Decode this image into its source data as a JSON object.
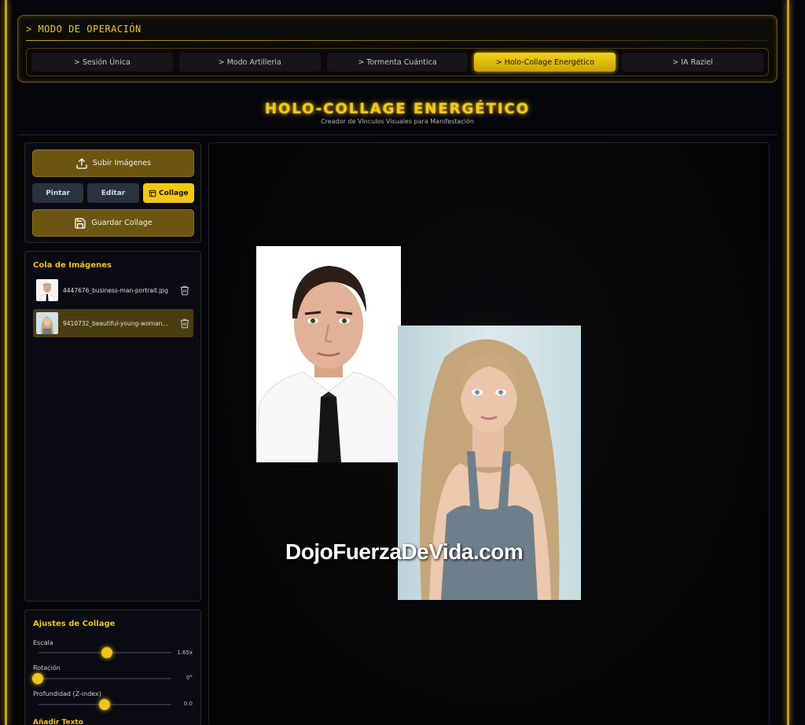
{
  "mode": {
    "title": "> MODO DE OPERACIÓN",
    "tabs": [
      {
        "label": "> Sesión Única",
        "active": false
      },
      {
        "label": "> Modo Artilleria",
        "active": false
      },
      {
        "label": "> Tormenta Cuántica",
        "active": false
      },
      {
        "label": "> Holo-Collage Energético",
        "active": true
      },
      {
        "label": "> IA Raziel",
        "active": false
      }
    ]
  },
  "header": {
    "title": "HOLO-COLLAGE ENERGÉTICO",
    "subtitle": "Creador de Vínculos Visuales para Manifestación"
  },
  "tools": {
    "upload_label": "Subir Imágenes",
    "paint_label": "Pintar",
    "edit_label": "Editar",
    "collage_label": "Collage",
    "save_label": "Guardar Collage"
  },
  "queue": {
    "title": "Cola de Imágenes",
    "items": [
      {
        "name": "4447676_business-man-portrait.jpg",
        "selected": false
      },
      {
        "name": "9410732_beautiful-young-woman...",
        "selected": true
      }
    ]
  },
  "settings": {
    "title": "Ajustes de Collage",
    "scale": {
      "label": "Escala",
      "value": "1.65x",
      "level": 0.52
    },
    "rotation": {
      "label": "Rotación",
      "value": "0°",
      "level": 0.0
    },
    "depth": {
      "label": "Profundidad (Z-index)",
      "value": "0.0",
      "level": 0.5
    },
    "next_label": "Añadir Texto"
  },
  "canvas": {
    "watermark": "DojoFuerzaDeVida.com"
  },
  "colors": {
    "accent": "#f0c418",
    "accent_dark": "#6b5510",
    "background": "#05060a"
  }
}
